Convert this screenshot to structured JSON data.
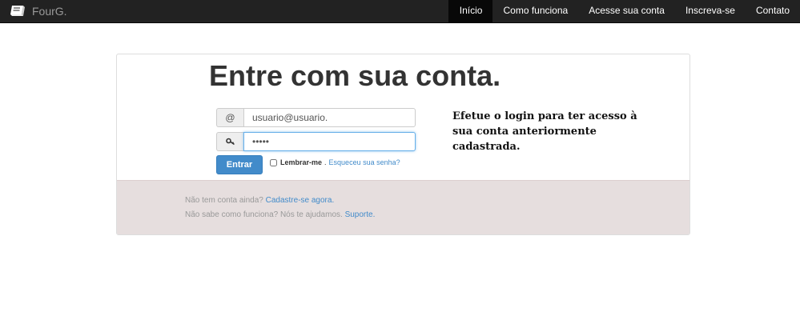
{
  "navbar": {
    "brand": "FourG.",
    "items": [
      {
        "label": "Início",
        "active": true
      },
      {
        "label": "Como funciona"
      },
      {
        "label": "Acesse sua conta"
      },
      {
        "label": "Inscreva-se"
      },
      {
        "label": "Contato"
      }
    ]
  },
  "login": {
    "title": "Entre com sua conta.",
    "email_value": "usuario@usuario.",
    "email_addon": "@",
    "password_value": "•••••",
    "password_addon_icon": "key-icon",
    "submit_label": "Entrar",
    "remember_label": "Lembrar-me",
    "separator": ".",
    "forgot_label": "Esqueceu sua senha?",
    "info_text": "Efetue o login para ter acesso à sua conta anteriormente cadastrada."
  },
  "footer": {
    "line1_text": "Não tem conta ainda?",
    "line1_link": "Cadastre-se agora.",
    "line2_text": "Não sabe como funciona? Nós te ajudamos.",
    "line2_link": "Suporte."
  },
  "colors": {
    "navbar_bg": "#222222",
    "primary": "#428bca",
    "footer_bg": "#e6dede"
  }
}
